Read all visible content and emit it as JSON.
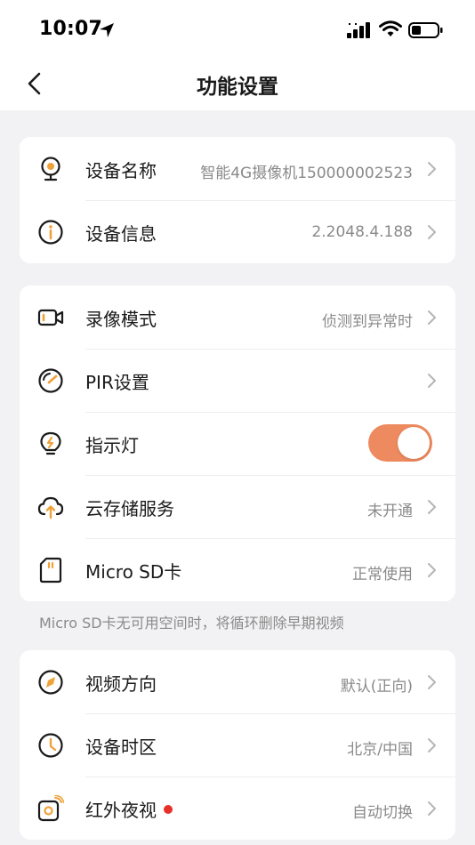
{
  "status_bar": {
    "time": "10:07"
  },
  "nav": {
    "title": "功能设置"
  },
  "groups": [
    {
      "rows": [
        {
          "label": "设备名称",
          "value": "智能4G摄像机150000002523",
          "icon": "camera-icon"
        },
        {
          "label": "设备信息",
          "value": "2.2048.4.188",
          "icon": "info-icon"
        }
      ]
    },
    {
      "rows": [
        {
          "label": "录像模式",
          "value": "侦测到异常时",
          "icon": "video-icon"
        },
        {
          "label": "PIR设置",
          "value": "",
          "icon": "gauge-icon"
        },
        {
          "label": "指示灯",
          "toggle": true,
          "icon": "bulb-icon"
        },
        {
          "label": "云存储服务",
          "value": "未开通",
          "icon": "cloud-upload-icon"
        },
        {
          "label": "Micro SD卡",
          "value": "正常使用",
          "icon": "sd-card-icon"
        }
      ]
    },
    {
      "rows": [
        {
          "label": "视频方向",
          "value": "默认(正向)",
          "icon": "compass-icon"
        },
        {
          "label": "设备时区",
          "value": "北京/中国",
          "icon": "clock-icon"
        },
        {
          "label": "红外夜视",
          "value": "自动切换",
          "icon": "infrared-icon",
          "badge": true
        }
      ]
    }
  ],
  "hint": "Micro SD卡无可用空间时，将循环删除早期视频",
  "colors": {
    "accent": "#ee8a5f",
    "icon_orange": "#f0a23a",
    "badge_red": "#e8302a",
    "secondary_text": "#8a8a8a",
    "background": "#f2f2f4"
  }
}
